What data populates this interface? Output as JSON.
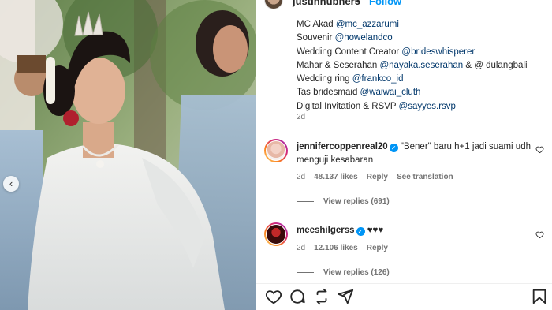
{
  "post_header": {
    "username": "justinhubner5",
    "follow_label": "Follow",
    "separator": "•",
    "more_label": "···"
  },
  "photo": {
    "nav_glyph": "‹"
  },
  "caption": {
    "lines": [
      {
        "prefix": "MC Akad ",
        "mention": "@mc_azzarumi",
        "suffix": ""
      },
      {
        "prefix": "Souvenir ",
        "mention": "@howelandco",
        "suffix": ""
      },
      {
        "prefix": "Wedding Content Creator ",
        "mention": "@brideswhisperer",
        "suffix": ""
      },
      {
        "prefix": "Mahar & Seserahan ",
        "mention": "@nayaka.seserahan",
        "suffix": " & @ dulangbali"
      },
      {
        "prefix": "Wedding ring ",
        "mention": "@frankco_id",
        "suffix": ""
      },
      {
        "prefix": "Tas bridesmaid ",
        "mention": "@waiwai_cluth",
        "suffix": ""
      },
      {
        "prefix": "Digital Invitation & RSVP ",
        "mention": "@sayyes.rsvp",
        "suffix": ""
      }
    ],
    "time": "2d"
  },
  "comments": [
    {
      "username": "jennifercoppenreal20",
      "verified": true,
      "text": " \"Bener\" baru h+1 jadi suami udh menguji kesabaran",
      "time": "2d",
      "likes": "48.137 likes",
      "reply_label": "Reply",
      "translation_label": "See translation",
      "view_replies": "View replies (691)"
    },
    {
      "username": "meeshilgerss",
      "verified": true,
      "text": " ♥♥♥",
      "time": "2d",
      "likes": "12.106 likes",
      "reply_label": "Reply",
      "view_replies": "View replies (126)"
    }
  ],
  "icons": {
    "like": "heart-icon",
    "comment": "comment-icon",
    "share": "share-icon",
    "repost": "repost-icon",
    "save": "bookmark-icon",
    "comment_like": "heart-outline-icon"
  },
  "colors": {
    "mention": "#00376b",
    "follow": "#0095f6",
    "verified": "#0095f6",
    "meta": "#737373"
  }
}
